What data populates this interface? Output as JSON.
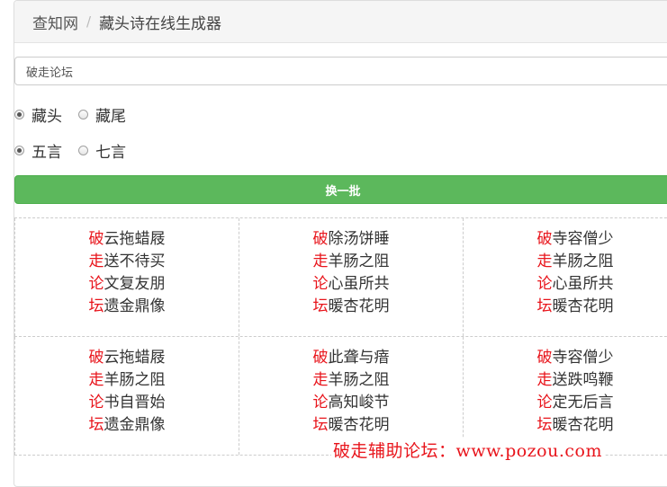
{
  "breadcrumb": {
    "home": "查知网",
    "separator": "/",
    "current": "藏头诗在线生成器"
  },
  "input": {
    "value": "破走论坛"
  },
  "position_options": [
    {
      "label": "藏头",
      "checked": true
    },
    {
      "label": "藏尾",
      "checked": false
    }
  ],
  "length_options": [
    {
      "label": "五言",
      "checked": true
    },
    {
      "label": "七言",
      "checked": false
    }
  ],
  "refresh_button": "换一批",
  "poems": [
    [
      {
        "head": "破",
        "rest": "云拖蜡屐"
      },
      {
        "head": "走",
        "rest": "送不待买"
      },
      {
        "head": "论",
        "rest": "文复友朋"
      },
      {
        "head": "坛",
        "rest": "遗金鼎像"
      }
    ],
    [
      {
        "head": "破",
        "rest": "除汤饼睡"
      },
      {
        "head": "走",
        "rest": "羊肠之阻"
      },
      {
        "head": "论",
        "rest": "心虽所共"
      },
      {
        "head": "坛",
        "rest": "暖杏花明"
      }
    ],
    [
      {
        "head": "破",
        "rest": "寺容僧少"
      },
      {
        "head": "走",
        "rest": "羊肠之阻"
      },
      {
        "head": "论",
        "rest": "心虽所共"
      },
      {
        "head": "坛",
        "rest": "暖杏花明"
      }
    ],
    [
      {
        "head": "破",
        "rest": "云拖蜡屐"
      },
      {
        "head": "走",
        "rest": "羊肠之阻"
      },
      {
        "head": "论",
        "rest": "书自晋始"
      },
      {
        "head": "坛",
        "rest": "遗金鼎像"
      }
    ],
    [
      {
        "head": "破",
        "rest": "此聋与瘖"
      },
      {
        "head": "走",
        "rest": "羊肠之阻"
      },
      {
        "head": "论",
        "rest": "高知峻节"
      },
      {
        "head": "坛",
        "rest": "暖杏花明"
      }
    ],
    [
      {
        "head": "破",
        "rest": "寺容僧少"
      },
      {
        "head": "走",
        "rest": "送跌鸣鞭"
      },
      {
        "head": "论",
        "rest": "定无后言"
      },
      {
        "head": "坛",
        "rest": "暖杏花明"
      }
    ]
  ],
  "watermark": "破走辅助论坛：www.pozou.com",
  "colors": {
    "head_char": "#e8141b",
    "button_bg": "#5cb85c",
    "breadcrumb_bg": "#f5f5f5"
  }
}
